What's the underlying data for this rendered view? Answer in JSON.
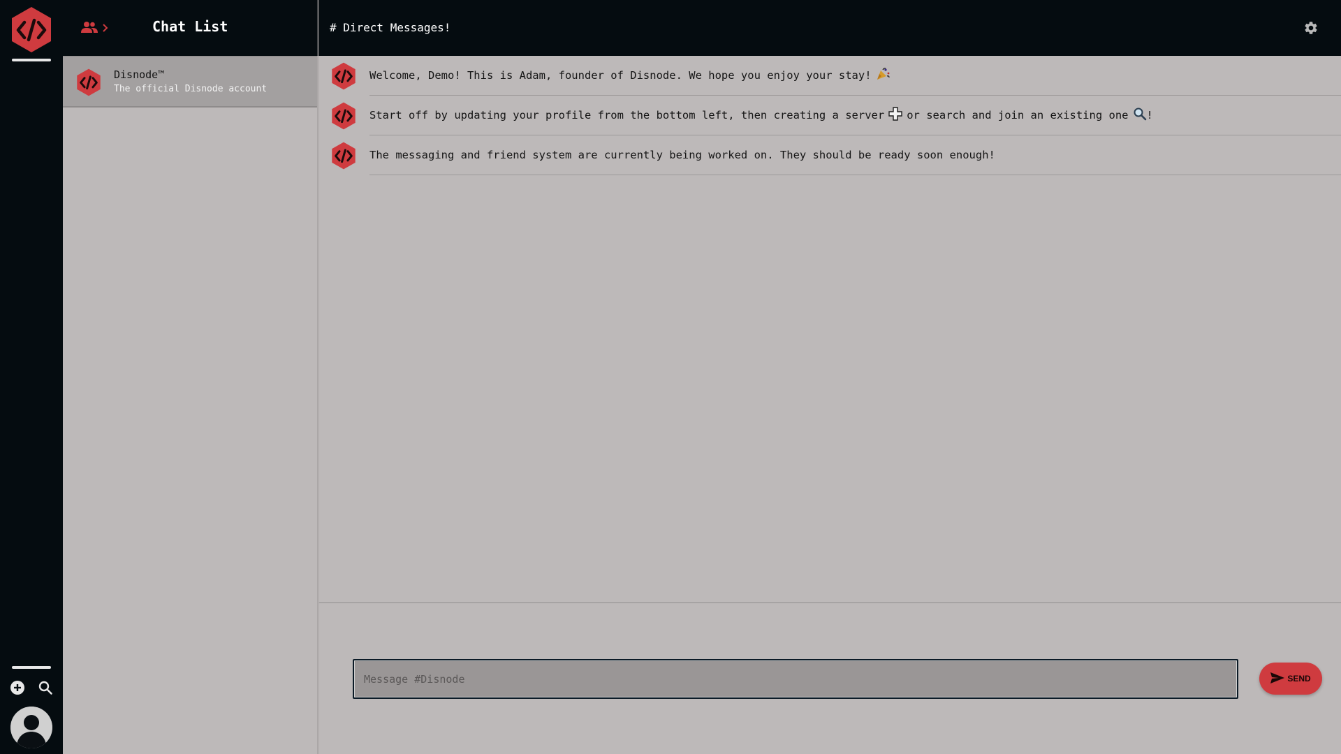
{
  "colors": {
    "rail_bg": "#050c10",
    "accent_red": "#cf3b3f",
    "panel_bg": "#bdb9b9",
    "selected_item_bg": "#a3a0a0"
  },
  "rail": {
    "logo_icon": "disnode-logo-icon",
    "add_icon": "plus-circle-icon",
    "search_icon": "search-icon",
    "avatar_icon": "user-avatar-icon"
  },
  "chatlist": {
    "friends_icon": "users-icon",
    "chevron_icon": "chevron-right-icon",
    "title": "Chat List",
    "items": [
      {
        "name": "Disnode™",
        "subtitle": "The official Disnode account",
        "avatar_icon": "disnode-logo-icon"
      }
    ]
  },
  "header": {
    "channel_title": "# Direct Messages!",
    "settings_icon": "gear-icon"
  },
  "messages": [
    {
      "text": "Welcome, Demo! This is Adam, founder of Disnode. We hope you enjoy your stay!",
      "trailing_icon": "party-popper-icon"
    },
    {
      "text_before": "Start off by updating your profile from the bottom left, then creating a server",
      "text_middle": "or search and join an existing one",
      "text_end": "!",
      "icon_one": "plus-icon",
      "icon_two": "search-icon"
    },
    {
      "text": "The messaging and friend system are currently being worked on. They should be ready soon enough!"
    }
  ],
  "composer": {
    "placeholder": "Message #Disnode",
    "value": "",
    "send_label": "SEND",
    "send_icon": "send-icon"
  }
}
